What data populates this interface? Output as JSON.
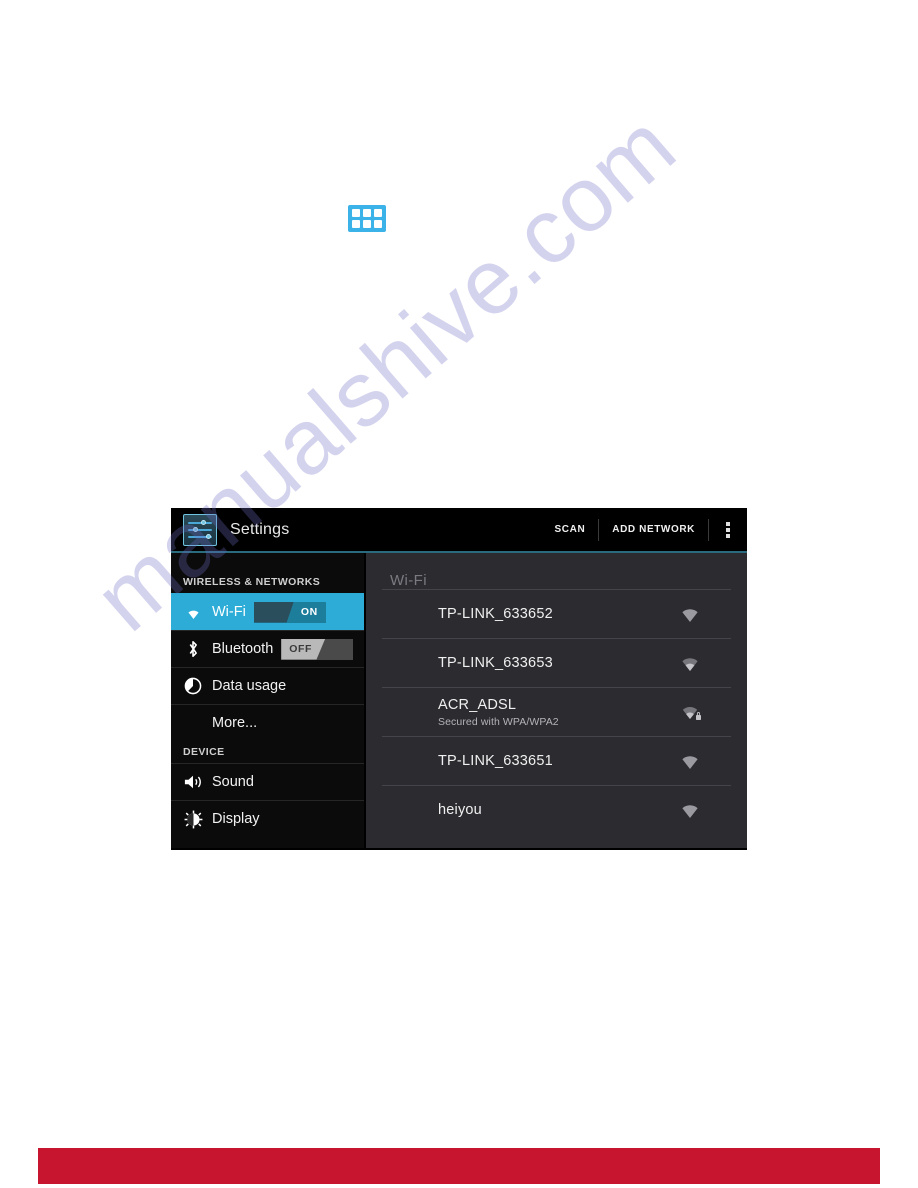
{
  "page": {
    "background_color": "#ffffff",
    "watermark_text": "manualshive.com",
    "watermark_color": "#6c6cc8",
    "footer_bar_color": "#c8152f"
  },
  "drawer_icon": {
    "name": "app-drawer-icon",
    "color": "#3cb3e8",
    "tiles": [
      "",
      "",
      "",
      "",
      "",
      ""
    ]
  },
  "screenshot": {
    "action_bar": {
      "app_icon_name": "settings-slider-icon",
      "title": "Settings",
      "actions": [
        {
          "label": "SCAN",
          "name": "scan-button"
        },
        {
          "label": "ADD NETWORK",
          "name": "add-network-button"
        }
      ],
      "overflow_name": "overflow-menu-icon"
    },
    "sidebar": {
      "sections": [
        {
          "header": "WIRELESS & NETWORKS",
          "items": [
            {
              "label": "Wi-Fi",
              "icon": "wifi-icon",
              "selected": true,
              "toggle": {
                "state": "on",
                "label": "ON"
              }
            },
            {
              "label": "Bluetooth",
              "icon": "bluetooth-icon",
              "selected": false,
              "toggle": {
                "state": "off",
                "label": "OFF"
              }
            },
            {
              "label": "Data usage",
              "icon": "data-usage-icon",
              "selected": false
            },
            {
              "label": "More...",
              "icon": null,
              "selected": false
            }
          ]
        },
        {
          "header": "DEVICE",
          "items": [
            {
              "label": "Sound",
              "icon": "sound-icon",
              "selected": false
            },
            {
              "label": "Display",
              "icon": "display-icon",
              "selected": false
            }
          ]
        }
      ]
    },
    "content": {
      "title": "Wi-Fi",
      "networks": [
        {
          "ssid": "TP-LINK_633652",
          "security": null,
          "signal": 4,
          "locked": false
        },
        {
          "ssid": "TP-LINK_633653",
          "security": null,
          "signal": 3,
          "locked": false
        },
        {
          "ssid": "ACR_ADSL",
          "security": "Secured with WPA/WPA2",
          "signal": 3,
          "locked": true
        },
        {
          "ssid": "TP-LINK_633651",
          "security": null,
          "signal": 4,
          "locked": false
        },
        {
          "ssid": "heiyou",
          "security": null,
          "signal": 4,
          "locked": false
        }
      ]
    }
  }
}
